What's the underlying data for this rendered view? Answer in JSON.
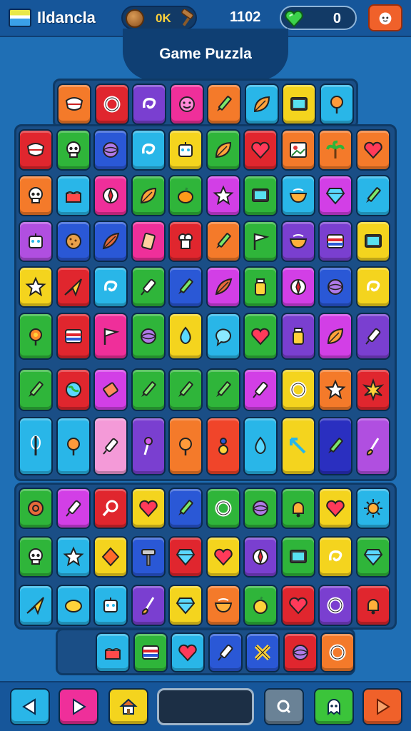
{
  "header": {
    "app_title": "Ildancla",
    "coin_label": "0K",
    "score": "1102",
    "gem_count": "0",
    "flag_icon": "flag-icon",
    "coin_icon": "coin-icon",
    "hammer_icon": "hammer-icon",
    "gem_icon": "heart-gem-icon",
    "menu_icon": "cat-face-icon"
  },
  "banner": {
    "title": "Game Puzzla"
  },
  "board": {
    "rows": [
      [
        "#f47a2a",
        "#e0262e",
        "#7a3fd0",
        "#ef2f9a",
        "#f47a2a",
        "#29b6e8",
        "#f4d41e",
        "#29b6e8"
      ],
      [
        "#e0262e",
        "#2fb53a",
        "#2a58d6",
        "#29b6e8",
        "#f4d41e",
        "#2fb53a",
        "#e0262e",
        "#f47a2a",
        "#f47a2a",
        "#f47a2a"
      ],
      [
        "#f47a2a",
        "#29b6e8",
        "#ef2f9a",
        "#2fb53a",
        "#2fb53a",
        "#d23fe6",
        "#2fb53a",
        "#29b6e8",
        "#d23fe6",
        "#29b6e8"
      ],
      [
        "#b04fe0",
        "#2a58d6",
        "#2a58d6",
        "#ef2f9a",
        "#e0262e",
        "#f47a2a",
        "#2fb53a",
        "#7a3fd0",
        "#7a3fd0",
        "#f4d41e"
      ],
      [
        "#f4d41e",
        "#e0262e",
        "#29b6e8",
        "#2fb53a",
        "#2a58d6",
        "#d23fe6",
        "#2fb53a",
        "#d23fe6",
        "#2a58d6",
        "#f4d41e"
      ],
      [
        "#2fb53a",
        "#e0262e",
        "#ef2f9a",
        "#2fb53a",
        "#f4d41e",
        "#29b6e8",
        "#2fb53a",
        "#7a3fd0",
        "#d23fe6",
        "#7a3fd0"
      ],
      [
        "#2fb53a",
        "#e0262e",
        "#d23fe6",
        "#2fb53a",
        "#2fb53a",
        "#2fb53a",
        "#d23fe6",
        "#f4d41e",
        "#f47a2a",
        "#e0262e"
      ],
      [
        "#29b6e8",
        "#29b6e8",
        "#f49ad8",
        "#7a3fd0",
        "#f47a2a",
        "#f0452a",
        "#29b6e8",
        "#f4d41e",
        "#2a2fc0",
        "#b04fe0"
      ],
      [
        "#2fb53a",
        "#d23fe6",
        "#e0262e",
        "#f4d41e",
        "#2a58d6",
        "#2fb53a",
        "#2fb53a",
        "#2fb53a",
        "#f4d41e",
        "#29b6e8"
      ],
      [
        "#2fb53a",
        "#29b6e8",
        "#f4d41e",
        "#2a58d6",
        "#e0262e",
        "#f4d41e",
        "#7a3fd0",
        "#2fb53a",
        "#f4d41e",
        "#2fb53a"
      ],
      [
        "#29b6e8",
        "#29b6e8",
        "#29b6e8",
        "#7a3fd0",
        "#f4d41e",
        "#f47a2a",
        "#2fb53a",
        "#e0262e",
        "#7a3fd0",
        "#e0262e"
      ],
      [
        "#29b6e8",
        "#2fb53a",
        "#29b6e8",
        "#2a58d6",
        "#2a58d6",
        "#e0262e",
        "#f47a2a"
      ]
    ],
    "icons": [
      [
        "teeth",
        "ring",
        "swirl",
        "face",
        "pencil",
        "leaf",
        "screen",
        "lollipop"
      ],
      [
        "teeth",
        "skull",
        "ball",
        "swirl",
        "robot",
        "leaf",
        "heart",
        "picture",
        "palm",
        "heart"
      ],
      [
        "skull",
        "cake",
        "compass",
        "leaf",
        "pumpkin",
        "star",
        "screen",
        "bowl",
        "gem",
        "pencil"
      ],
      [
        "robot",
        "cookie",
        "feather",
        "scroll",
        "chef",
        "pencil",
        "flag",
        "bowl",
        "stripes",
        "screen"
      ],
      [
        "star",
        "plane",
        "swirl",
        "syringe",
        "pencil",
        "feather",
        "jar",
        "compass",
        "ball",
        "swirl"
      ],
      [
        "flower",
        "stripes",
        "flag",
        "ball",
        "drop",
        "bubble",
        "heart",
        "jar",
        "leaf",
        "syringe"
      ],
      [
        "pencil",
        "globe",
        "eraser",
        "pencil",
        "pencil",
        "pencil",
        "syringe",
        "ring",
        "star",
        "burst"
      ],
      [
        "whisk",
        "lollipop",
        "syringe",
        "wand",
        "lollipop",
        "gear",
        "drop",
        "arrow",
        "pencil",
        "brush"
      ],
      [
        "roll",
        "syringe",
        "magnifier",
        "heart",
        "pencil",
        "ring",
        "ball",
        "bell",
        "heart",
        "sun"
      ],
      [
        "skull",
        "star",
        "diamond",
        "hammer",
        "gem",
        "heart",
        "compass",
        "screen",
        "swirl",
        "gem"
      ],
      [
        "plane",
        "lemon",
        "robot",
        "brush",
        "gem",
        "bowl",
        "apple",
        "heart",
        "ring",
        "bell"
      ],
      [
        "cake",
        "stripes",
        "heart",
        "syringe",
        "cross",
        "ball",
        "ring"
      ]
    ]
  },
  "footer": {
    "left_icon": "arrow-left-icon",
    "play_icon": "arrow-right-icon",
    "home_icon": "house-icon",
    "input_value": "",
    "search_icon": "q-letter-icon",
    "pet_icon": "ghost-icon",
    "next_icon": "arrow-right-icon"
  }
}
